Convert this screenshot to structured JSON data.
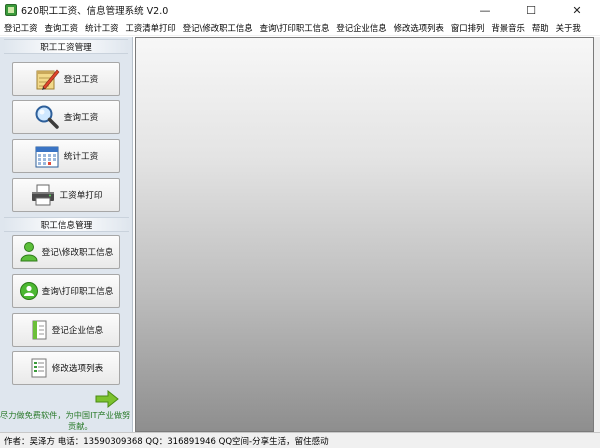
{
  "window": {
    "title": "620职工工资、信息管理系统 V2.0",
    "minimize_glyph": "—",
    "maximize_glyph": "☐",
    "close_glyph": "✕"
  },
  "menu": [
    "登记工资",
    "查询工资",
    "统计工资",
    "工资清单打印",
    "登记\\修改职工信息",
    "查询\\打印职工信息",
    "登记企业信息",
    "修改选项列表",
    "窗口排列",
    "背景音乐",
    "帮助",
    "关于我"
  ],
  "sidebar": {
    "section1": "职工工资管理",
    "buttons1": [
      {
        "label": "登记工资",
        "icon": "pencil-notepad-icon"
      },
      {
        "label": "查询工资",
        "icon": "magnifier-icon"
      },
      {
        "label": "统计工资",
        "icon": "calendar-icon"
      },
      {
        "label": "工资单打印",
        "icon": "printer-icon"
      }
    ],
    "section2": "职工信息管理",
    "buttons2": [
      {
        "label": "登记\\修改职工信息",
        "icon": "user-add-icon"
      },
      {
        "label": "查询\\打印职工信息",
        "icon": "user-search-icon"
      },
      {
        "label": "登记企业信息",
        "icon": "document-icon"
      },
      {
        "label": "修改选项列表",
        "icon": "list-icon"
      }
    ],
    "marquee_line1": "尽力做免费软件，为中国IT产业做努",
    "marquee_line2": "贡献。"
  },
  "statusbar": {
    "text": "作者：吴泽方 电话：13590309368  QQ：316891946  QQ空间-分享生活，留住感动"
  },
  "colors": {
    "sidebar_bg": "#dfe6ee",
    "marquee_text": "#2a7a2a",
    "accent_green": "#3a9a3a"
  }
}
